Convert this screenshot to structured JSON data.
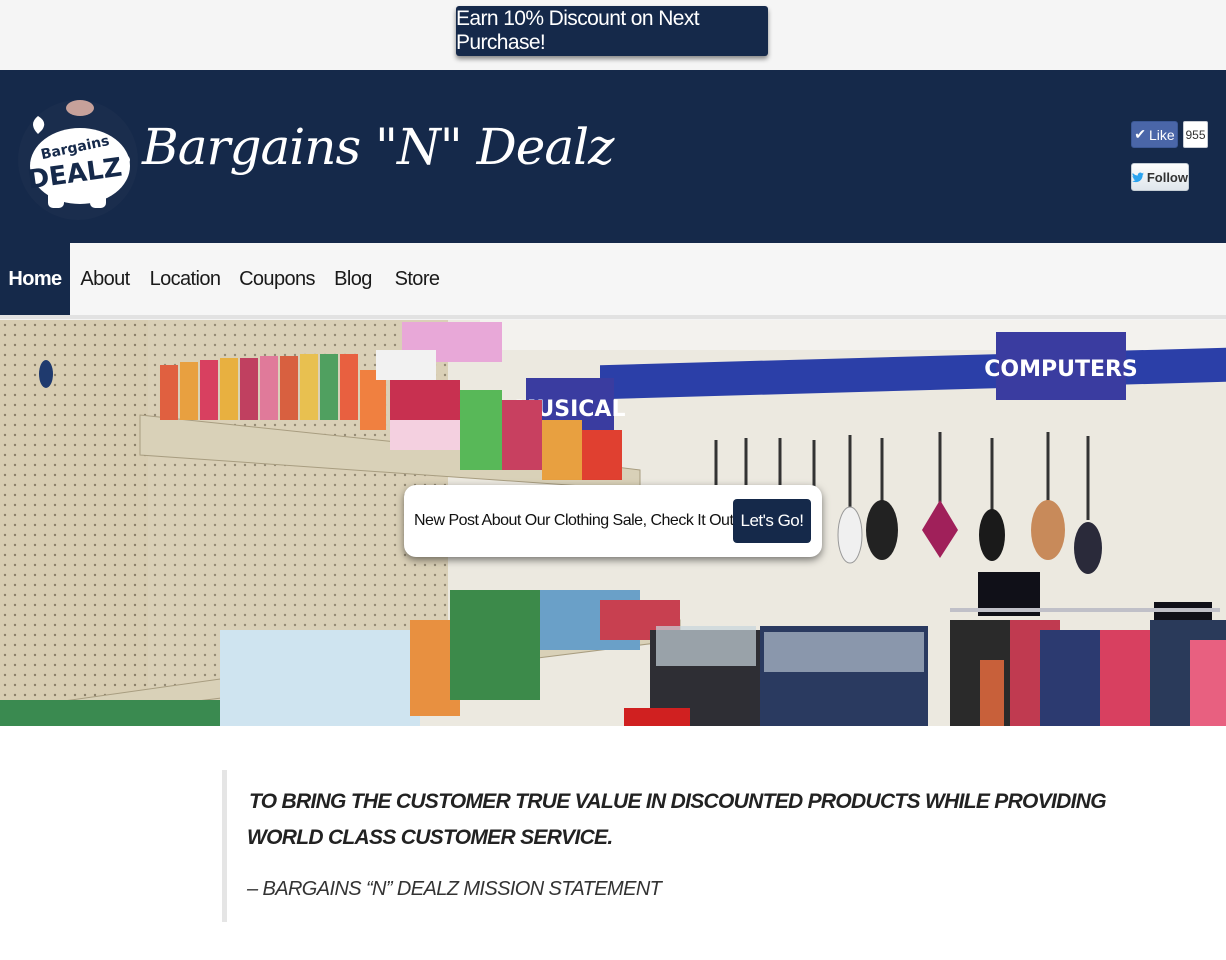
{
  "promo": {
    "label": "Earn 10% Discount on Next Purchase!"
  },
  "header": {
    "logo_text": "Bargains DEALZ",
    "site_title": "Bargains \"N\" Dealz",
    "social": {
      "like_label": "Like",
      "like_count": "955",
      "follow_label": "Follow"
    }
  },
  "nav": {
    "items": [
      "Home",
      "About",
      "Location",
      "Coupons",
      "Blog",
      "Store"
    ],
    "active": "Home"
  },
  "hero": {
    "signs": {
      "musical": "MUSICAL",
      "computers": "COMPUTERS"
    },
    "callout": {
      "text": "New Post About Our Clothing Sale, Check It Out!",
      "button": "Let's Go!"
    }
  },
  "mission": {
    "line1": " TO BRING THE CUSTOMER TRUE VALUE IN DISCOUNTED PRODUCTS WHILE PROVIDING",
    "line2": "WORLD CLASS CUSTOMER SERVICE.",
    "citation": "– BARGAINS “N” DEALZ MISSION STATEMENT"
  },
  "colors": {
    "navy": "#15294a",
    "facebook": "#4a66a8",
    "accent_blue": "#2b3fa8"
  }
}
